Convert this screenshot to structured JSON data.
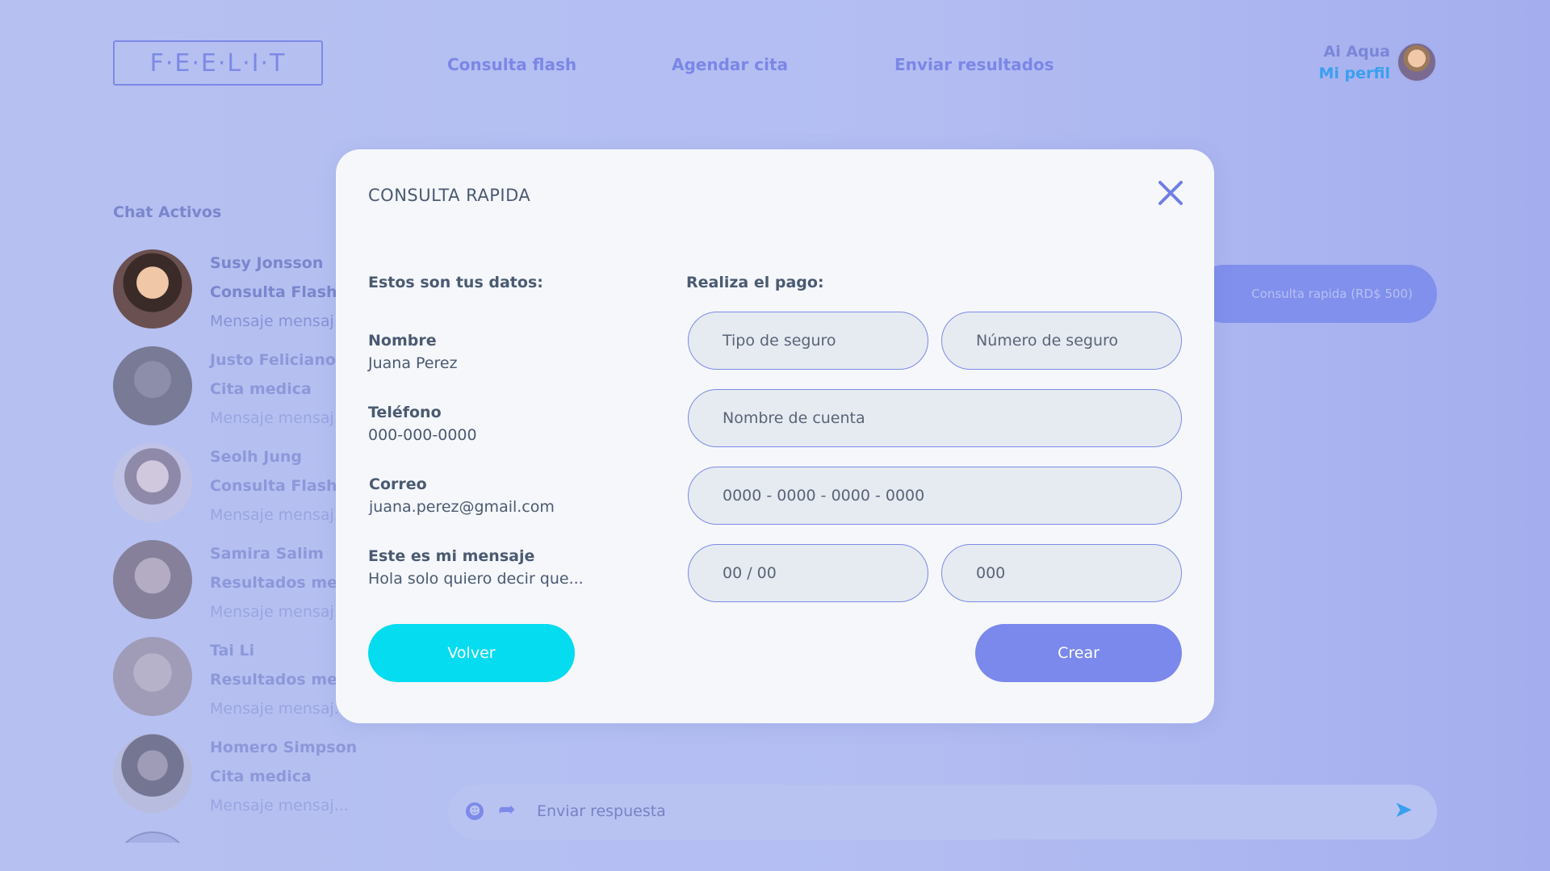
{
  "header": {
    "logo": "F·E·E·L·I·T",
    "nav": [
      "Consulta flash",
      "Agendar cita",
      "Enviar resultados"
    ],
    "user_name": "Ai Aqua",
    "profile_link": "Mi perfil"
  },
  "sidebar": {
    "title": "Chat Activos",
    "chats": [
      {
        "name": "Susy Jonsson",
        "type": "Consulta Flash",
        "message": "Mensaje mensaj..."
      },
      {
        "name": "Justo Feliciano",
        "type": "Cita medica",
        "message": "Mensaje mensaj..."
      },
      {
        "name": "Seolh Jung",
        "type": "Consulta Flash",
        "message": "Mensaje mensaj..."
      },
      {
        "name": "Samira Salim",
        "type": "Resultados medi",
        "message": "Mensaje mensaj..."
      },
      {
        "name": "Tai Li",
        "type": "Resultados medi",
        "message": "Mensaje mensaj..."
      },
      {
        "name": "Homero Simpson",
        "type": "Cita medica",
        "message": "Mensaje mensaj..."
      }
    ]
  },
  "main": {
    "quick_consult_label": "Consulta rapida (RD$ 500)",
    "reply_placeholder": "Enviar respuesta"
  },
  "modal": {
    "title": "CONSULTA RAPIDA",
    "left_heading": "Estos son tus datos:",
    "right_heading": "Realiza el pago:",
    "fields": [
      {
        "label": "Nombre",
        "value": "Juana Perez"
      },
      {
        "label": "Teléfono",
        "value": "000-000-0000"
      },
      {
        "label": "Correo",
        "value": "juana.perez@gmail.com"
      },
      {
        "label": "Este es mi mensaje",
        "value": "Hola solo quiero decir que..."
      }
    ],
    "inputs": {
      "insurance_type": "Tipo de seguro",
      "insurance_number": "Número de seguro",
      "account_name": "Nombre de cuenta",
      "card_number": "0000 - 0000 - 0000 - 0000",
      "expiry": "00 / 00",
      "cvv": "000"
    },
    "back_label": "Volver",
    "create_label": "Crear"
  },
  "colors": {
    "background": "#b3bdf2",
    "accent": "#7b88ec",
    "cyan": "#05dcf0",
    "link_blue": "#3aa0ee",
    "modal_bg": "#f5f7fb"
  }
}
